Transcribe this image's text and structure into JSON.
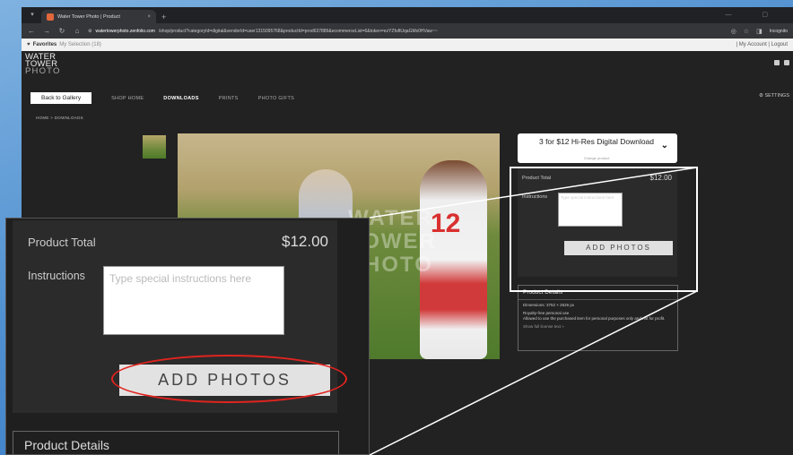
{
  "browser": {
    "tab_title": "Water Tower Photo | Product",
    "tab_close": "×",
    "new_tab": "+",
    "url_domain": "watertowerphoto.zenfolio.com",
    "url_path": "/shop/product?categoryId=digital&vendorId=user1315095768&productId=prod637886&ecommerceList=6&token=ezYZfuftUqaGMx0HVaw~~",
    "incognito_label": "Incognito",
    "window_controls": "— ▢"
  },
  "favbar": {
    "favorites_label": "Favorites",
    "selection_label": "My Selection (18)",
    "account_links": "| My Account | Logout"
  },
  "site": {
    "logo_line1": "WATER",
    "logo_line2": "TOWER",
    "logo_line3": "PHOTO",
    "back_label": "Back to Gallery",
    "menu": [
      "SHOP HOME",
      "DOWNLOADS",
      "PRINTS",
      "PHOTO GIFTS"
    ],
    "settings_label": "SETTINGS",
    "breadcrumb": "HOME > DOWNLOADS"
  },
  "photo": {
    "jersey_number": "12",
    "watermark": "WATER TOWER PHOTO"
  },
  "product": {
    "name": "3 for $12 Hi-Res Digital Download",
    "change_label": "Change product",
    "total_label": "Product Total",
    "price": "$12.00",
    "instructions_label": "Instructions",
    "instructions_placeholder": "Type special instructions here",
    "add_button": "ADD PHOTOS"
  },
  "details": {
    "title": "Product Details",
    "dimensions": "Dimensions: 3752 × 2626 px",
    "license_title": "Royalty-free personal use",
    "license_text": "Allowed to use the purchased item for personal purposes only and not for profit.",
    "license_link": "Show full license text »"
  },
  "colors": {
    "highlight": "#e0241f",
    "page_bg": "#222222",
    "panel_bg": "#2b2b2b"
  }
}
